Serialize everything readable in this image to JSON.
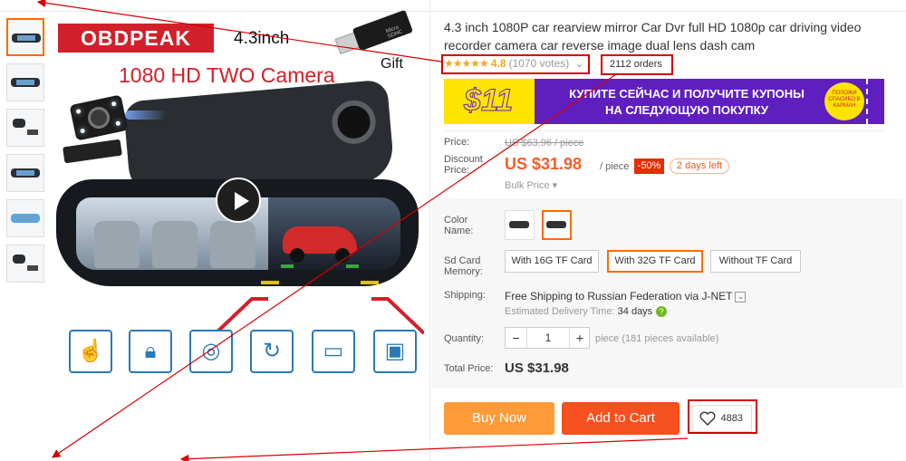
{
  "gallery": {
    "thumbnails": [
      "thumbnail-1",
      "thumbnail-2",
      "thumbnail-3",
      "thumbnail-4",
      "thumbnail-5",
      "thumbnail-6"
    ],
    "active_index": 0,
    "image": {
      "brand": "OBDPEAK",
      "size": "4.3inch",
      "camera_title": "1080 HD TWO Camera",
      "gift": "Gift",
      "sd_text": "Micro SDHC"
    },
    "feature_icons": [
      "touch-icon",
      "lock-icon",
      "film-reel-icon",
      "loop-record-icon",
      "cctv-camera-icon",
      "monitor-icon"
    ]
  },
  "product": {
    "title": "4.3 inch 1080P car rearview mirror Car Dvr full HD 1080p car driving video recorder camera car reverse image dual lens dash cam",
    "rating": 4.8,
    "rating_label": "4.8",
    "votes": "(1070 votes)",
    "orders": "2112 orders"
  },
  "banner": {
    "amount": "$11",
    "line1": "КУПИТЕ СЕЙЧАС И ПОЛУЧИТЕ КУПОНЫ",
    "line2": "НА СЛЕДУЮЩУЮ ПОКУПКУ",
    "badge": "ПОЛОЖИ СПАСИБО В КАРМАН"
  },
  "price": {
    "label": "Price:",
    "original": "US $63.96 / piece",
    "discount_label": "Discount Price:",
    "current": "US $31.98",
    "unit": "/ piece",
    "discount": "-50%",
    "days_left": "2 days left",
    "bulk": "Bulk Price ▾"
  },
  "options": {
    "color_label": "Color Name:",
    "sd_label": "Sd Card Memory:",
    "sd_options": [
      "With 16G TF Card",
      "With 32G TF Card",
      "Without TF Card"
    ],
    "sd_selected": 1
  },
  "shipping": {
    "label": "Shipping:",
    "text": "Free Shipping to Russian Federation via J-NET",
    "eta_label": "Estimated Delivery Time:",
    "eta_value": "34 days"
  },
  "quantity": {
    "label": "Quantity:",
    "value": "1",
    "minus": "−",
    "plus": "+",
    "hint": "piece (181 pieces available)"
  },
  "total": {
    "label": "Total Price:",
    "value": "US $31.98"
  },
  "actions": {
    "buy_now": "Buy Now",
    "add_to_cart": "Add to Cart",
    "wishlist_count": "4883"
  },
  "colors": {
    "accent": "#ff6a00",
    "price": "#f65d27",
    "buy_now": "#ff9a38",
    "add_to_cart": "#f5501d",
    "annotation": "#d50000",
    "banner": "#5f1fbf"
  }
}
